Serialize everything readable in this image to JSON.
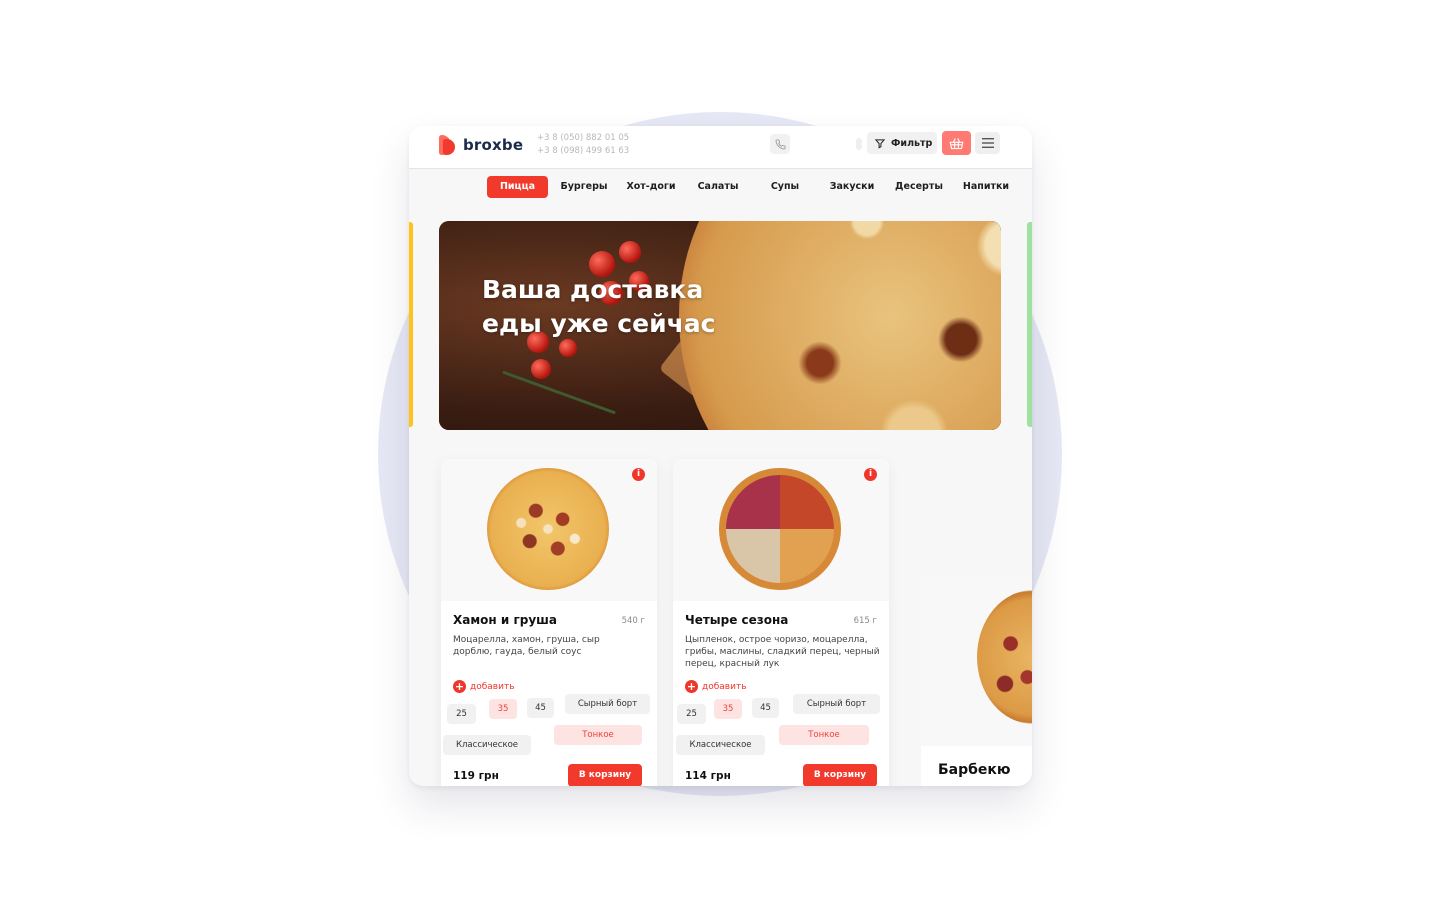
{
  "brand": {
    "name": "broxbe",
    "accent": "#f23a2c"
  },
  "header": {
    "phones": [
      "+3 8 (050) 882 01 05",
      "+3 8 (098) 499 61 63"
    ],
    "filter_label": "Фильтр",
    "icons": {
      "phone": "phone-icon",
      "filter": "filter-icon",
      "cart": "basket-icon",
      "menu": "hamburger-icon"
    }
  },
  "nav": {
    "items": [
      {
        "label": "Пицца",
        "active": true
      },
      {
        "label": "Бургеры"
      },
      {
        "label": "Хот-доги"
      },
      {
        "label": "Салаты"
      },
      {
        "label": "Супы"
      },
      {
        "label": "Закуски"
      },
      {
        "label": "Десерты"
      },
      {
        "label": "Напитки"
      }
    ]
  },
  "banner": {
    "title_line1": "Ваша доставка",
    "title_line2": "еды уже сейчас"
  },
  "products": [
    {
      "title": "Хамон и груша",
      "weight": "540 г",
      "description": "Моцарелла, хамон, груша, сыр дорблю, гауда, белый соус",
      "add_label": "добавить",
      "sizes": [
        "25",
        "35",
        "45"
      ],
      "selected_size": "35",
      "crusts": [
        "Сырный борт",
        "Тонкое",
        "Классическое"
      ],
      "selected_crust": "Тонкое",
      "price": "119 грн",
      "cart_label": "В корзину"
    },
    {
      "title": "Четыре сезона",
      "weight": "615 г",
      "description": "Цыпленок, острое чоризо, моцарелла, грибы, маслины, сладкий перец, черный перец, красный лук",
      "add_label": "добавить",
      "sizes": [
        "25",
        "35",
        "45"
      ],
      "selected_size": "35",
      "crusts": [
        "Сырный борт",
        "Тонкое",
        "Классическое"
      ],
      "selected_crust": "Тонкое",
      "price": "114 грн",
      "cart_label": "В корзину"
    },
    {
      "title": "Барбекю"
    }
  ]
}
